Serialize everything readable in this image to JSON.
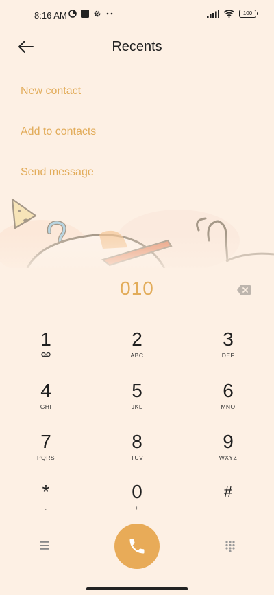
{
  "status": {
    "time": "8:16 AM",
    "battery": "100",
    "icons_left": [
      "data-saver-icon",
      "square-app-icon",
      "gear-icon",
      "more-dots-icon"
    ],
    "icons_right": [
      "signal-icon",
      "wifi-icon",
      "battery-icon"
    ]
  },
  "header": {
    "title": "Recents"
  },
  "menu": {
    "new_contact": "New contact",
    "add_to_contacts": "Add to contacts",
    "send_message": "Send message"
  },
  "dial": {
    "number": "010"
  },
  "keypad": {
    "keys": [
      {
        "digit": "1",
        "letters": "ꝏ"
      },
      {
        "digit": "2",
        "letters": "ABC"
      },
      {
        "digit": "3",
        "letters": "DEF"
      },
      {
        "digit": "4",
        "letters": "GHI"
      },
      {
        "digit": "5",
        "letters": "JKL"
      },
      {
        "digit": "6",
        "letters": "MNO"
      },
      {
        "digit": "7",
        "letters": "PQRS"
      },
      {
        "digit": "8",
        "letters": "TUV"
      },
      {
        "digit": "9",
        "letters": "WXYZ"
      },
      {
        "digit": "*",
        "letters": ","
      },
      {
        "digit": "0",
        "letters": "+"
      },
      {
        "digit": "#",
        "letters": ""
      }
    ]
  },
  "colors": {
    "accent": "#e2ac5a",
    "background": "#fdf0e4",
    "call_button": "#e8ab58"
  }
}
